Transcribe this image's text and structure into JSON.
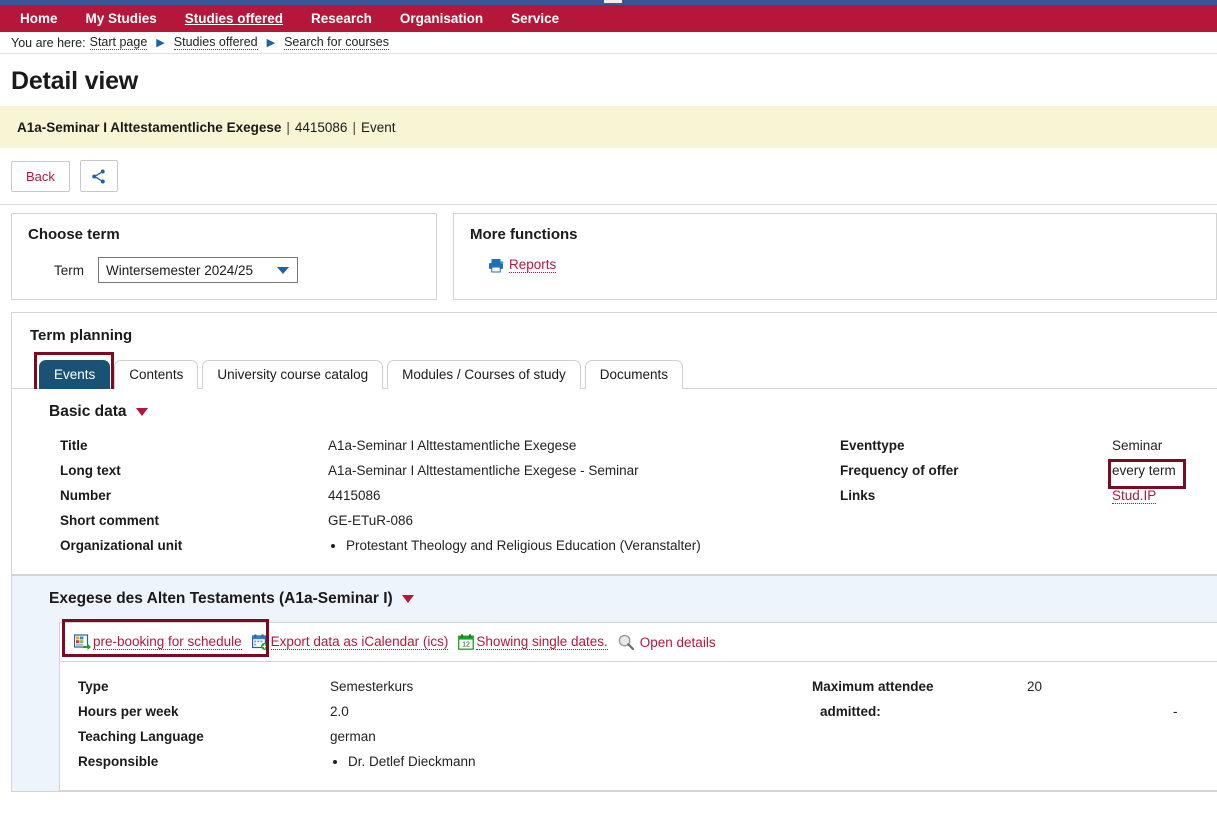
{
  "nav": {
    "items": [
      {
        "label": "Home",
        "active": false
      },
      {
        "label": "My Studies",
        "active": false
      },
      {
        "label": "Studies offered",
        "active": true
      },
      {
        "label": "Research",
        "active": false
      },
      {
        "label": "Organisation",
        "active": false
      },
      {
        "label": "Service",
        "active": false
      }
    ]
  },
  "breadcrumb": {
    "prefix": "You are here:",
    "items": [
      "Start page",
      "Studies offered",
      "Search for courses"
    ],
    "separator": "▶"
  },
  "page": {
    "title": "Detail view"
  },
  "banner": {
    "name": "A1a-Seminar I Alttestamentliche Exegese",
    "number": "4415086",
    "type": "Event",
    "separator": "|"
  },
  "toolbar": {
    "back_label": "Back",
    "share_icon": "share-icon"
  },
  "choose_term": {
    "heading": "Choose term",
    "label": "Term",
    "selected": "Wintersemester 2024/25",
    "options": [
      "Wintersemester 2024/25"
    ]
  },
  "more_functions": {
    "heading": "More functions",
    "reports_label": "Reports",
    "reports_icon": "printer-icon"
  },
  "term_planning": {
    "heading": "Term planning",
    "tabs": [
      {
        "label": "Events",
        "active": true
      },
      {
        "label": "Contents",
        "active": false
      },
      {
        "label": "University course catalog",
        "active": false
      },
      {
        "label": "Modules / Courses of study",
        "active": false
      },
      {
        "label": "Documents",
        "active": false
      }
    ]
  },
  "basic_data": {
    "heading": "Basic data",
    "left": [
      {
        "key": "Title",
        "value": "A1a-Seminar I Alttestamentliche Exegese"
      },
      {
        "key": "Long text",
        "value": "A1a-Seminar I Alttestamentliche Exegese - Seminar"
      },
      {
        "key": "Number",
        "value": "4415086"
      },
      {
        "key": "Short comment",
        "value": "GE-ETuR-086"
      },
      {
        "key": "Organizational unit",
        "value": "Protestant Theology and Religious Education (Veranstalter)",
        "list": true
      }
    ],
    "right": [
      {
        "key": "Eventtype",
        "value": "Seminar"
      },
      {
        "key": "Frequency of offer",
        "value": "every term"
      },
      {
        "key": "Links",
        "value": "Stud.IP",
        "link": true
      }
    ]
  },
  "exegese": {
    "heading": "Exegese des Alten Testaments (A1a-Seminar I)",
    "actions": [
      {
        "label": "pre-booking for schedule",
        "icon": "prebooking-icon",
        "underline": true
      },
      {
        "label": "Export data as iCalendar (ics)",
        "icon": "calendar-export-icon",
        "underline": true
      },
      {
        "label": "Showing single dates.",
        "icon": "calendar-dates-icon",
        "underline": true
      },
      {
        "label": "Open details",
        "icon": "magnifier-icon",
        "underline": false
      }
    ],
    "left": [
      {
        "key": "Type",
        "value": "Semesterkurs"
      },
      {
        "key": "Hours per week",
        "value": "2.0"
      },
      {
        "key": "Teaching Language",
        "value": "german"
      },
      {
        "key": "Responsible",
        "value": "Dr. Detlef Dieckmann",
        "list": true
      }
    ],
    "right": [
      {
        "key": "Maximum attendee",
        "value": "20",
        "sub": false
      },
      {
        "key": "admitted:",
        "value": "-",
        "sub": true
      }
    ]
  },
  "colors": {
    "nav_red": "#b5173b",
    "top_blue": "#3b5597",
    "banner_yellow": "#f7f5d4",
    "highlight_box": "#7c0a20",
    "active_tab": "#1a5275",
    "link_red": "#b5173b",
    "section_blue": "#eef4fb"
  }
}
